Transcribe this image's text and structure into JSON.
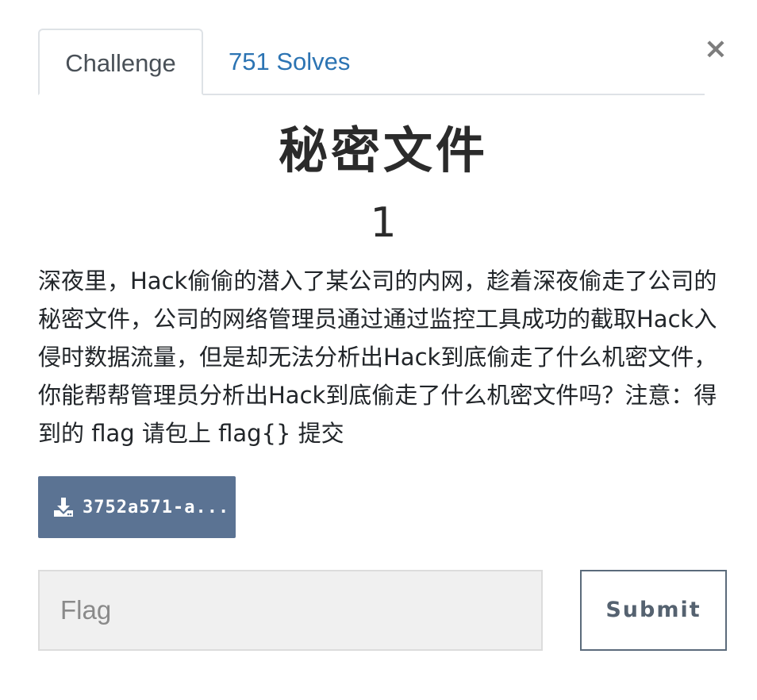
{
  "modal": {
    "close_label": "×"
  },
  "tabs": [
    {
      "label": "Challenge",
      "active": true
    },
    {
      "label": "751 Solves",
      "active": false
    }
  ],
  "challenge": {
    "name": "秘密文件",
    "value": "1",
    "description": "深夜里，Hack偷偷的潜入了某公司的内网，趁着深夜偷走了公司的秘密文件，公司的网络管理员通过通过监控工具成功的截取Hack入侵时数据流量，但是却无法分析出Hack到底偷走了什么机密文件，你能帮帮管理员分析出Hack到底偷走了什么机密文件吗？注意：得到的 flag 请包上 flag{} 提交"
  },
  "file": {
    "label": "3752a571-a...",
    "icon": "download-icon"
  },
  "submission": {
    "placeholder": "Flag",
    "value": "",
    "submit_label": "Submit"
  },
  "colors": {
    "link": "#2c74b3",
    "file_button_bg": "#5b7393",
    "input_bg": "#f0f0f0",
    "submit_border": "#5b6b7b"
  }
}
